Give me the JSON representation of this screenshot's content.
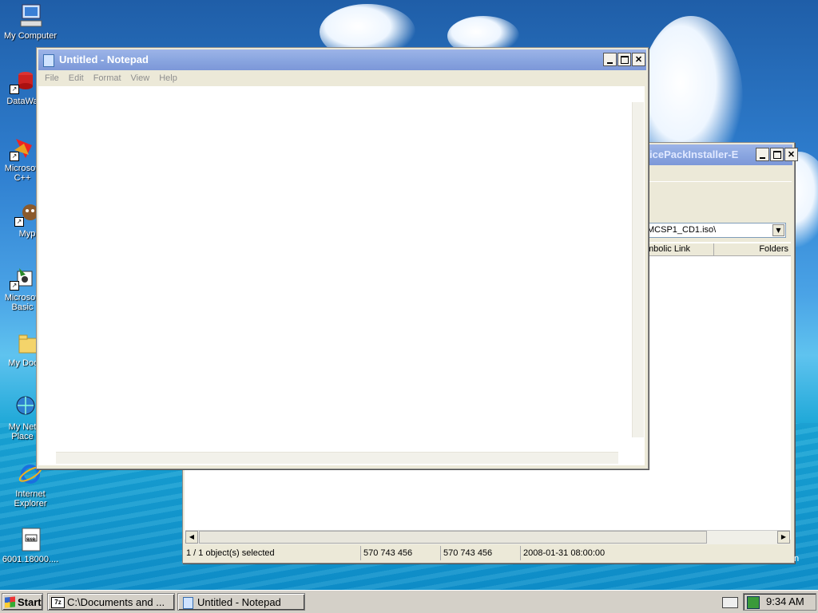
{
  "desktop": {
    "icons": [
      {
        "label": "My Computer"
      },
      {
        "label": "DataWa"
      },
      {
        "label": "Microsoft C++"
      },
      {
        "label": "Myp"
      },
      {
        "label": "Microsoft Basic"
      },
      {
        "label": "My Docu"
      },
      {
        "label": "My Net Place"
      },
      {
        "label": "Internet Explorer"
      },
      {
        "label": "6001.18000...."
      }
    ]
  },
  "notepad": {
    "title": "Untitled - Notepad",
    "menu": [
      "File",
      "Edit",
      "Format",
      "View",
      "Help"
    ],
    "content": ""
  },
  "explorer": {
    "title_fragment": "icePackInstaller-E",
    "address_value": "MCSP1_CD1.iso\\",
    "columns": [
      "mbolic Link",
      "Folders"
    ],
    "status": {
      "selection": "1 / 1 object(s) selected",
      "size1": "570 743 456",
      "size2": "570 743 456",
      "date": "2008-01-31 08:00:00"
    },
    "edge_char": "n"
  },
  "taskbar": {
    "start_label": "Start",
    "buttons": [
      {
        "label": "C:\\Documents and ...",
        "icon": "7z-icon",
        "active": false
      },
      {
        "label": "Untitled - Notepad",
        "icon": "notepad-icon",
        "active": true
      }
    ],
    "clock": "9:34 AM"
  },
  "colors": {
    "title_inactive": "#8aa6e0",
    "taskbar": "#d4d0c8",
    "window_face": "#ece9d8"
  }
}
